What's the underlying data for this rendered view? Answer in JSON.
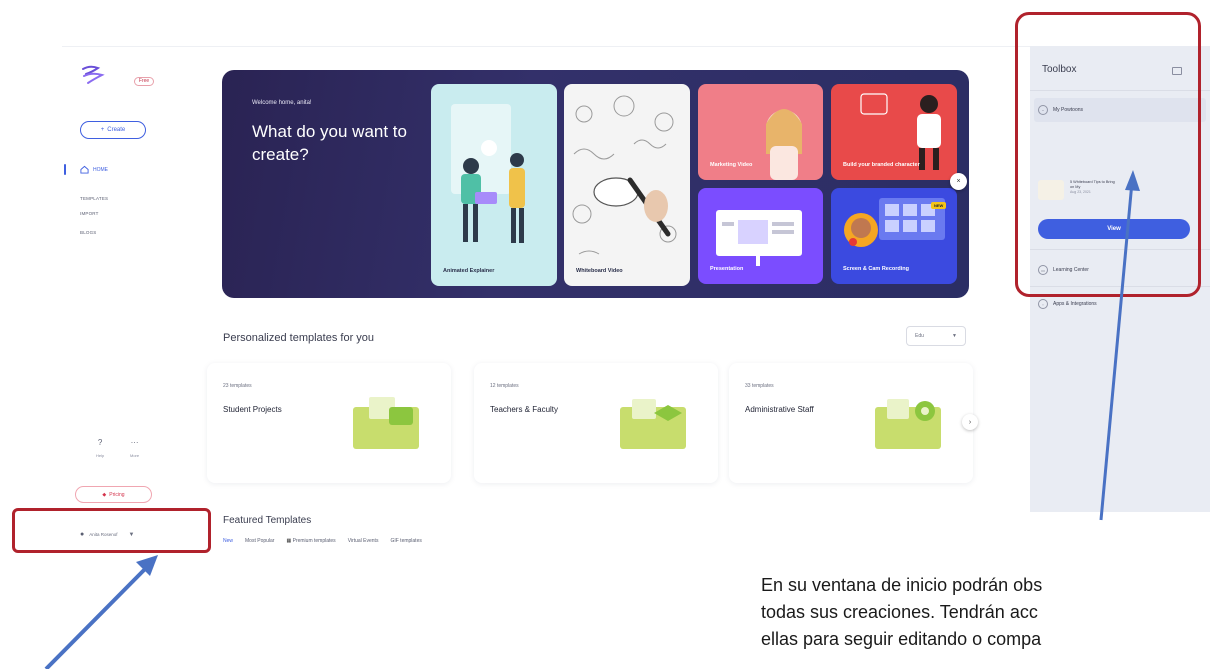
{
  "sidebar": {
    "plan_badge": "Free",
    "create_label": "Create",
    "nav": [
      {
        "label": "HOME"
      },
      {
        "label": "TEMPLATES"
      },
      {
        "label": "IMPORT"
      },
      {
        "label": "BLOGS"
      }
    ],
    "help_label": "Help",
    "more_label": "More",
    "pricing_label": "Pricing",
    "user_name": "Anita Rosenof"
  },
  "hero": {
    "welcome": "Welcome home, anita!",
    "title": "What do you want to create?",
    "cards": [
      {
        "label": "Animated Explainer"
      },
      {
        "label": "Whiteboard Video"
      },
      {
        "label": "Marketing Video"
      },
      {
        "label": "Build your branded character"
      },
      {
        "label": "Presentation"
      },
      {
        "label": "Screen & Cam Recording",
        "badge": "NEW"
      }
    ]
  },
  "personalized": {
    "title": "Personalized templates for you",
    "sort_label": "Edu",
    "cards": [
      {
        "count": "23 templates",
        "name": "Student Projects"
      },
      {
        "count": "12 templates",
        "name": "Teachers & Faculty"
      },
      {
        "count": "33 templates",
        "name": "Administrative Staff"
      }
    ]
  },
  "featured": {
    "title": "Featured Templates",
    "tabs": [
      "New",
      "Most Popular",
      "Premium templates",
      "Virtual Events",
      "GIF templates"
    ]
  },
  "toolbox": {
    "title": "Toolbox",
    "my_powtoons": "My Powtoons",
    "item_title": "5 Whiteboard Tips to Bring on My",
    "item_date": "Aug 23, 2021",
    "view_label": "View",
    "learning_center": "Learning Center",
    "apps": "Apps & Integrations"
  },
  "annotation": {
    "caption_line1": "En su ventana de inicio podrán obs",
    "caption_line2": "todas sus creaciones. Tendrán acc",
    "caption_line3": "ellas para seguir editando o compa"
  },
  "colors": {
    "accent": "#3f5fe0",
    "hero_bg": "#2a2353",
    "annotation_red": "#b0222c",
    "annotation_arrow": "#4a72c4"
  }
}
